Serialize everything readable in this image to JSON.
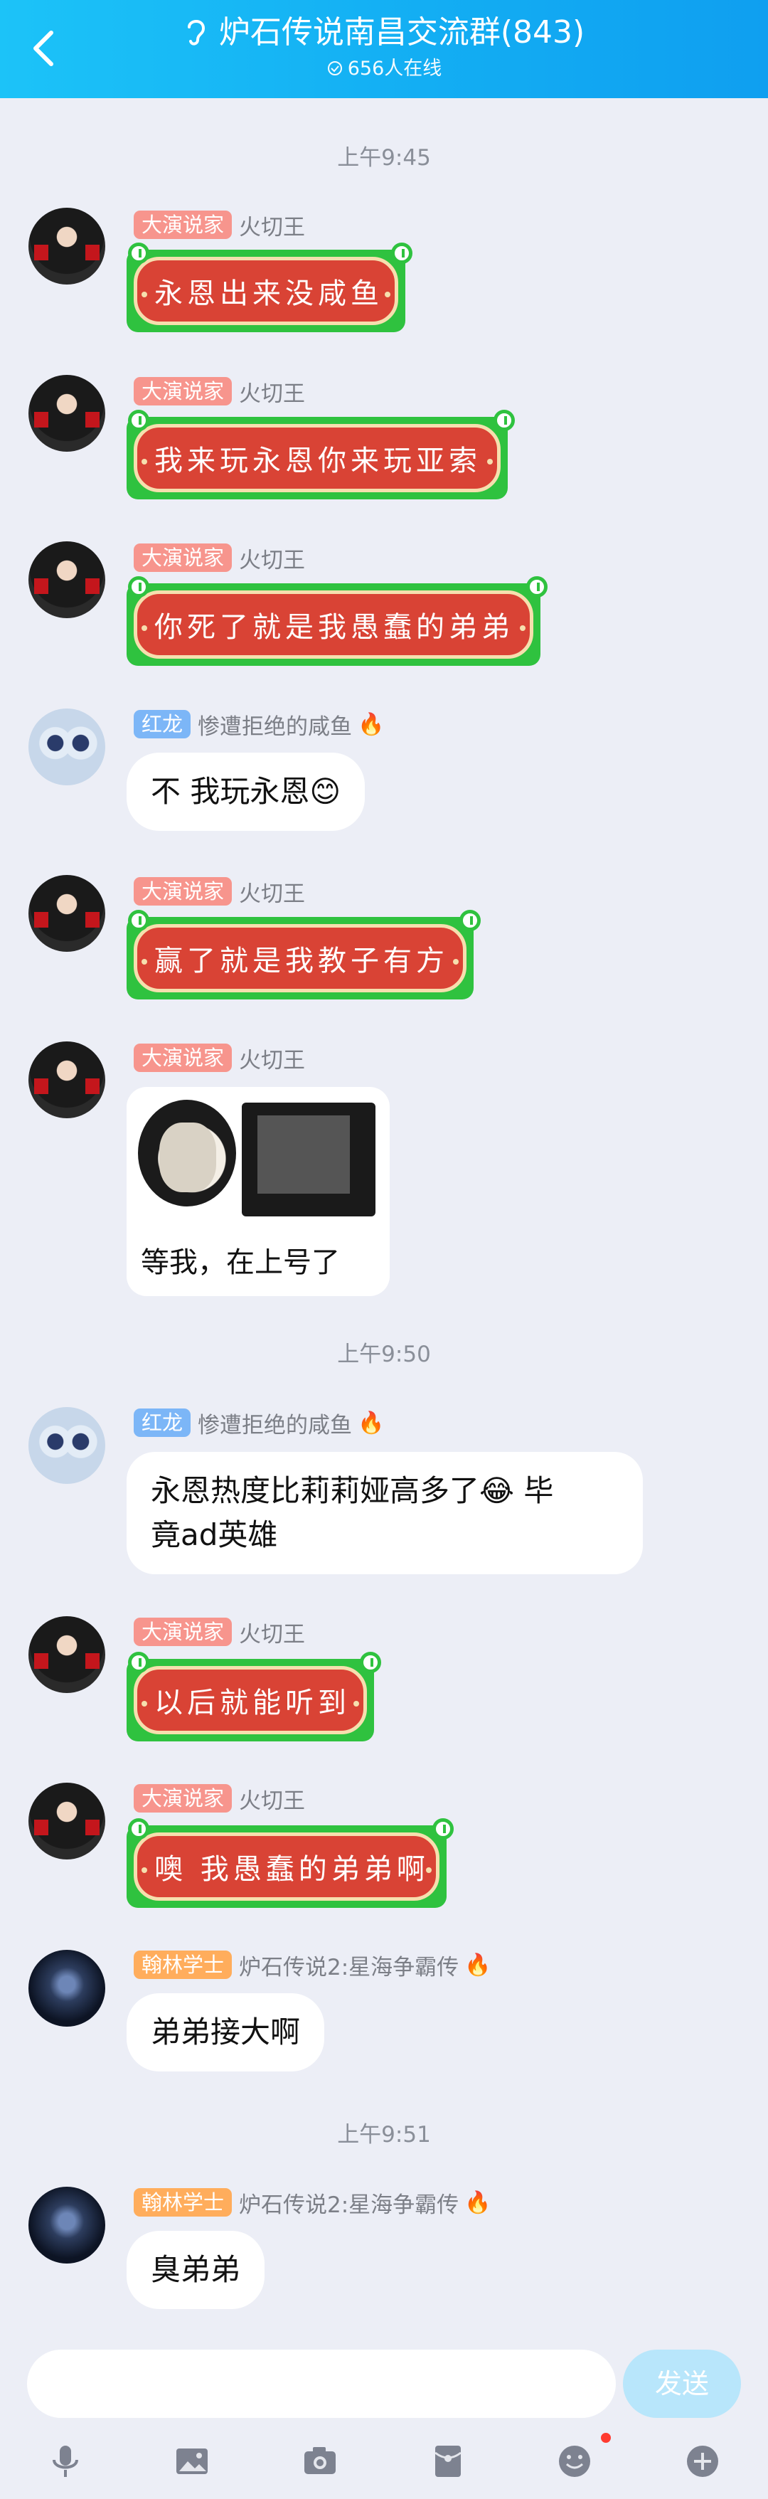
{
  "header": {
    "title": "炉石传说南昌交流群(843)",
    "online": "656人在线"
  },
  "timestamps": [
    "上午9:45",
    "上午9:50",
    "上午9:51"
  ],
  "messages": [
    {
      "badge": "大演说家",
      "nick": "火切王",
      "text": "永恩出来没咸鱼"
    },
    {
      "badge": "大演说家",
      "nick": "火切王",
      "text": "我来玩永恩你来玩亚索"
    },
    {
      "badge": "大演说家",
      "nick": "火切王",
      "text": "你死了就是我愚蠢的弟弟"
    },
    {
      "badge": "红龙",
      "nick": "惨遭拒绝的咸鱼",
      "text": "不 我玩永恩😊"
    },
    {
      "badge": "大演说家",
      "nick": "火切王",
      "text": "赢了就是我教子有方"
    },
    {
      "badge": "大演说家",
      "nick": "火切王",
      "image_caption": "等我，在上号了"
    },
    {
      "badge": "红龙",
      "nick": "惨遭拒绝的咸鱼",
      "text_line1": "永恩热度比莉莉娅高多了😂  毕",
      "text_line2": "竟ad英雄"
    },
    {
      "badge": "大演说家",
      "nick": "火切王",
      "text": "以后就能听到"
    },
    {
      "badge": "大演说家",
      "nick": "火切王",
      "text": "噢 我愚蠢的弟弟啊"
    },
    {
      "badge": "翰林学士",
      "nick": "炉石传说2:星海争霸传",
      "text": "弟弟接大啊"
    },
    {
      "badge": "翰林学士",
      "nick": "炉石传说2:星海争霸传",
      "text": "臭弟弟"
    }
  ],
  "input": {
    "placeholder": "",
    "send_label": "发送"
  },
  "toolbar": [
    "microphone-icon",
    "image-icon",
    "camera-icon",
    "red-packet-icon",
    "emoji-icon",
    "plus-icon"
  ],
  "colors": {
    "header": "#13aef3",
    "badge_red": "#f7958d",
    "badge_blue": "#7cb6f7",
    "badge_orange": "#ffad5c",
    "festive_green": "#2fc23f",
    "festive_red": "#d94335"
  }
}
